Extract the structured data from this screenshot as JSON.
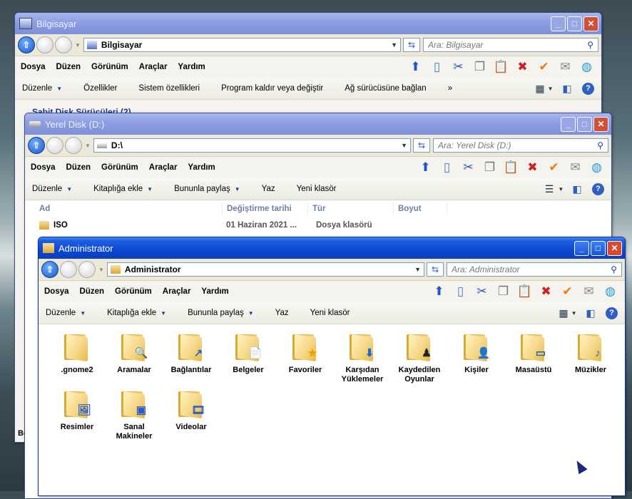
{
  "windows": {
    "computer": {
      "title": "Bilgisayar",
      "address": "Bilgisayar",
      "search_placeholder": "Ara: Bilgisayar",
      "menu": [
        "Dosya",
        "Düzen",
        "Görünüm",
        "Araçlar",
        "Yardım"
      ],
      "commands": [
        "Düzenle",
        "Özellikler",
        "Sistem özellikleri",
        "Program kaldır veya değiştir",
        "Ağ sürücüsüne bağlan",
        "»"
      ],
      "section_header": "Sabit Disk Sürücüleri (2)",
      "status_fragment": "Bo"
    },
    "drive": {
      "title": "Yerel Disk (D:)",
      "address": "D:\\",
      "search_placeholder": "Ara: Yerel Disk (D:)",
      "menu": [
        "Dosya",
        "Düzen",
        "Görünüm",
        "Araçlar",
        "Yardım"
      ],
      "commands": [
        "Düzenle",
        "Kitaplığa ekle",
        "Bununla paylaş",
        "Yaz",
        "Yeni klasör"
      ],
      "columns": [
        "Ad",
        "Değiştirme tarihi",
        "Tür",
        "Boyut"
      ],
      "rows": [
        {
          "name": "ISO",
          "date": "01 Haziran 2021 ...",
          "type": "Dosya klasörü",
          "size": ""
        }
      ]
    },
    "admin": {
      "title": "Administrator",
      "address": "Administrator",
      "search_placeholder": "Ara: Administrator",
      "menu": [
        "Dosya",
        "Düzen",
        "Görünüm",
        "Araçlar",
        "Yardım"
      ],
      "commands": [
        "Düzenle",
        "Kitaplığa ekle",
        "Bununla paylaş",
        "Yaz",
        "Yeni klasör"
      ],
      "folders": [
        {
          "label": ".gnome2",
          "icon": "folder-icon"
        },
        {
          "label": "Aramalar",
          "icon": "searches-folder-icon"
        },
        {
          "label": "Bağlantılar",
          "icon": "links-folder-icon"
        },
        {
          "label": "Belgeler",
          "icon": "documents-folder-icon"
        },
        {
          "label": "Favoriler",
          "icon": "favorites-folder-icon"
        },
        {
          "label": "Karşıdan Yüklemeler",
          "icon": "downloads-folder-icon"
        },
        {
          "label": "Kaydedilen Oyunlar",
          "icon": "saved-games-folder-icon"
        },
        {
          "label": "Kişiler",
          "icon": "contacts-folder-icon"
        },
        {
          "label": "Masaüstü",
          "icon": "desktop-folder-icon"
        },
        {
          "label": "Müzikler",
          "icon": "music-folder-icon"
        },
        {
          "label": "Resimler",
          "icon": "pictures-folder-icon"
        },
        {
          "label": "Sanal Makineler",
          "icon": "virtual-machines-folder-icon"
        },
        {
          "label": "Videolar",
          "icon": "videos-folder-icon"
        }
      ]
    }
  },
  "colors": {
    "inactive_title": "#8f9fe2",
    "active_title": "#0a47d3",
    "close_button": "#d84a2c"
  }
}
